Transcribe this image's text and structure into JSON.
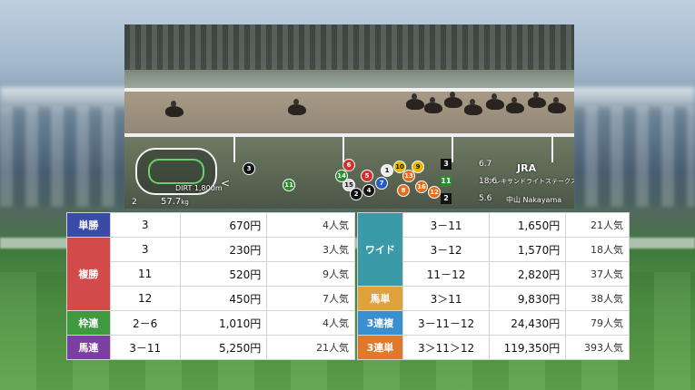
{
  "video": {
    "course": "DIRT 1,800m",
    "weight": "57.7",
    "weight_unit": "kg",
    "pace_label": "2",
    "broadcaster": "JRA",
    "race_name": "アレキサンドライトステークス",
    "venue": "中山 Nakayama",
    "leaders": [
      {
        "num": "3",
        "odds": "6.7",
        "color": "#111111"
      },
      {
        "num": "11",
        "odds": "18.6",
        "color": "#2e8b2e"
      },
      {
        "num": "2",
        "odds": "5.6",
        "color": "#111111"
      }
    ],
    "position_numbers": [
      "3",
      "11",
      "6",
      "5",
      "7",
      "15",
      "1",
      "4",
      "10",
      "9",
      "16",
      "12",
      "13",
      "14",
      "8",
      "2"
    ]
  },
  "payouts_left": [
    {
      "type": "単勝",
      "color": "#3a4aa8",
      "rows": [
        {
          "combo": "3",
          "payout": "670円",
          "popularity": "4人気"
        }
      ]
    },
    {
      "type": "複勝",
      "color": "#d24a4a",
      "rows": [
        {
          "combo": "3",
          "payout": "230円",
          "popularity": "3人気"
        },
        {
          "combo": "11",
          "payout": "520円",
          "popularity": "9人気"
        },
        {
          "combo": "12",
          "payout": "450円",
          "popularity": "7人気"
        }
      ]
    },
    {
      "type": "枠連",
      "color": "#3f9a3f",
      "rows": [
        {
          "combo": "2－6",
          "payout": "1,010円",
          "popularity": "4人気"
        }
      ]
    },
    {
      "type": "馬連",
      "color": "#7a3fa0",
      "rows": [
        {
          "combo": "3－11",
          "payout": "5,250円",
          "popularity": "21人気"
        }
      ]
    }
  ],
  "payouts_right": [
    {
      "type": "ワイド",
      "color": "#3a9aa8",
      "rows": [
        {
          "combo": "3－11",
          "payout": "1,650円",
          "popularity": "21人気"
        },
        {
          "combo": "3－12",
          "payout": "1,570円",
          "popularity": "18人気"
        },
        {
          "combo": "11－12",
          "payout": "2,820円",
          "popularity": "37人気"
        }
      ]
    },
    {
      "type": "馬単",
      "color": "#e0a23a",
      "rows": [
        {
          "combo": "3＞11",
          "payout": "9,830円",
          "popularity": "38人気"
        }
      ]
    },
    {
      "type": "3連複",
      "color": "#3a8fd0",
      "rows": [
        {
          "combo": "3－11－12",
          "payout": "24,430円",
          "popularity": "79人気"
        }
      ]
    },
    {
      "type": "3連単",
      "color": "#e07a2a",
      "rows": [
        {
          "combo": "3＞11＞12",
          "payout": "119,350円",
          "popularity": "393人気"
        }
      ]
    }
  ]
}
